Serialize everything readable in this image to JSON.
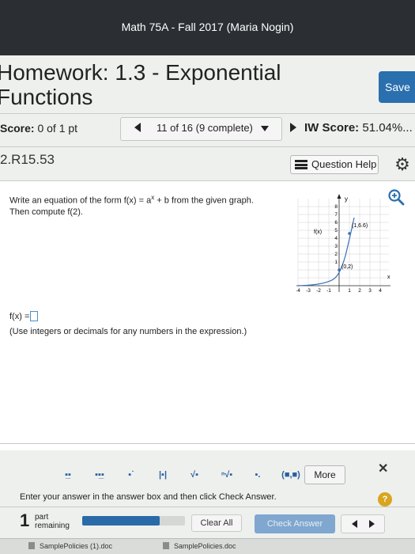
{
  "course_title": "Math 75A - Fall 2017 (Maria Nogin)",
  "homework": {
    "title": "Homework: 1.3 - Exponential Functions",
    "save_label": "Save"
  },
  "score": {
    "label": "Score:",
    "value": "0 of 1 pt"
  },
  "navigator": {
    "text": "11 of 16 (9 complete)"
  },
  "iw_score": {
    "label": "IW Score:",
    "value": "51.04%..."
  },
  "question": {
    "number": "2.R15.53",
    "help_label": "Question Help",
    "instruction_line1": "Write an equation of the form f(x) = a",
    "instruction_sup": "x",
    "instruction_line1_end": " + b from the given graph.",
    "instruction_line2": "Then compute f(2).",
    "answer_label": "f(x) =",
    "hint": "(Use integers or decimals for any numbers in the expression.)"
  },
  "graph": {
    "y_axis_label": "y",
    "x_axis_label": "x",
    "curve_label": "f(x)",
    "point_labels": [
      "(1,6.6)",
      "(0,2)"
    ],
    "y_ticks": [
      "8",
      "7",
      "6",
      "5",
      "4",
      "3",
      "2",
      "1"
    ],
    "x_ticks": [
      "-4",
      "-3",
      "-2",
      "-1",
      "1",
      "2",
      "3",
      "4"
    ],
    "points": [
      {
        "x": 1,
        "y": 6.6
      },
      {
        "x": 0,
        "y": 2
      }
    ]
  },
  "toolbar": {
    "more_label": "More",
    "interval_label": "(■,■)"
  },
  "answer_instruction": "Enter your answer in the answer box and then click Check Answer.",
  "help_symbol": "?",
  "parts": {
    "count": "1",
    "label_line1": "part",
    "label_line2": "remaining",
    "progress": 0.75
  },
  "actions": {
    "clear_label": "Clear All",
    "check_label": "Check Answer"
  },
  "downloads": [
    "SamplePolicies (1).doc",
    "SamplePolicies.doc"
  ],
  "colors": {
    "accent": "#2a6fae",
    "topbar": "#2b2f34",
    "help": "#d9a51e"
  }
}
